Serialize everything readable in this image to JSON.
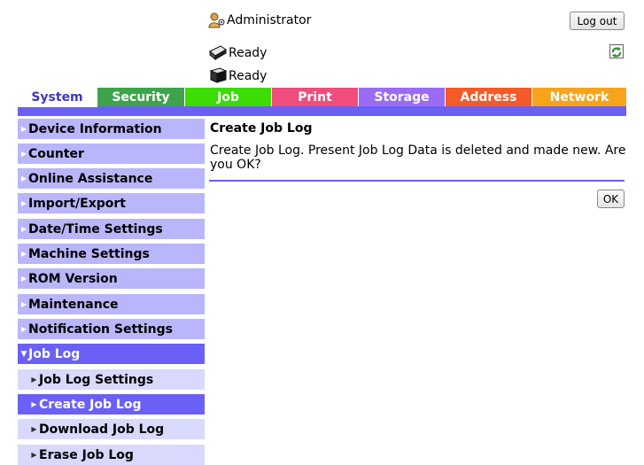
{
  "header": {
    "user": "Administrator",
    "logout_label": "Log out",
    "status": [
      "Ready",
      "Ready"
    ]
  },
  "tabs": [
    {
      "label": "System",
      "color": "#6a60f5",
      "active": true
    },
    {
      "label": "Security",
      "color": "#3fa34d"
    },
    {
      "label": "Job",
      "color": "#3cdc04"
    },
    {
      "label": "Print",
      "color": "#f04c7c"
    },
    {
      "label": "Storage",
      "color": "#9a6cf4"
    },
    {
      "label": "Address",
      "color": "#f45a2a"
    },
    {
      "label": "Network",
      "color": "#f8a31c"
    }
  ],
  "sidebar": {
    "items": [
      {
        "label": "Device Information"
      },
      {
        "label": "Counter"
      },
      {
        "label": "Online Assistance"
      },
      {
        "label": "Import/Export"
      },
      {
        "label": "Date/Time Settings"
      },
      {
        "label": "Machine Settings"
      },
      {
        "label": "ROM Version"
      },
      {
        "label": "Maintenance"
      },
      {
        "label": "Notification Settings"
      },
      {
        "label": "Job Log",
        "expanded": true
      },
      {
        "label": "Job Log Settings",
        "sub": true
      },
      {
        "label": "Create Job Log",
        "sub": true,
        "active": true
      },
      {
        "label": "Download Job Log",
        "sub": true
      },
      {
        "label": "Erase Job Log",
        "sub": true
      }
    ]
  },
  "main": {
    "title": "Create Job Log",
    "message": "Create Job Log. Present Job Log Data is deleted and made new. Are you OK?",
    "ok_label": "OK"
  },
  "icons": {
    "user": "administrator-icon",
    "printer": "printer-icon",
    "scanner": "scanner-icon",
    "refresh": "refresh-icon"
  }
}
